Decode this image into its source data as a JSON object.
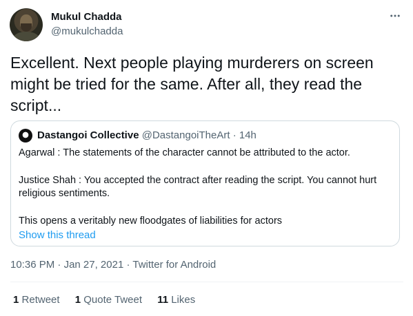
{
  "author": {
    "name": "Mukul Chadda",
    "handle": "@mukulchadda"
  },
  "more_icon": "more-horizontal-icon",
  "tweet_text": "Excellent. Next people playing murderers on screen\nmight be tried for the same. After all, they read the\nscript...",
  "quoted": {
    "name": "Dastangoi Collective",
    "handle": "@DastangoiTheArt",
    "separator": "·",
    "time": "14h",
    "paragraphs": [
      "Agarwal : The statements of the character cannot be attributed to the actor.",
      "Justice Shah : You accepted the contract after reading the script. You cannot hurt religious sentiments.",
      "This opens a veritably new floodgates of liabilities for actors"
    ],
    "thread_link": "Show this thread"
  },
  "meta": {
    "time": "10:36 PM",
    "date": "Jan 27, 2021",
    "source": "Twitter for Android",
    "separator": "·"
  },
  "stats": {
    "retweets": {
      "count": "1",
      "label": "Retweet"
    },
    "quotes": {
      "count": "1",
      "label": "Quote Tweet"
    },
    "likes": {
      "count": "11",
      "label": "Likes"
    }
  },
  "colors": {
    "link": "#1d9bf0",
    "secondary_text": "#536471",
    "border": "#cfd9de"
  }
}
